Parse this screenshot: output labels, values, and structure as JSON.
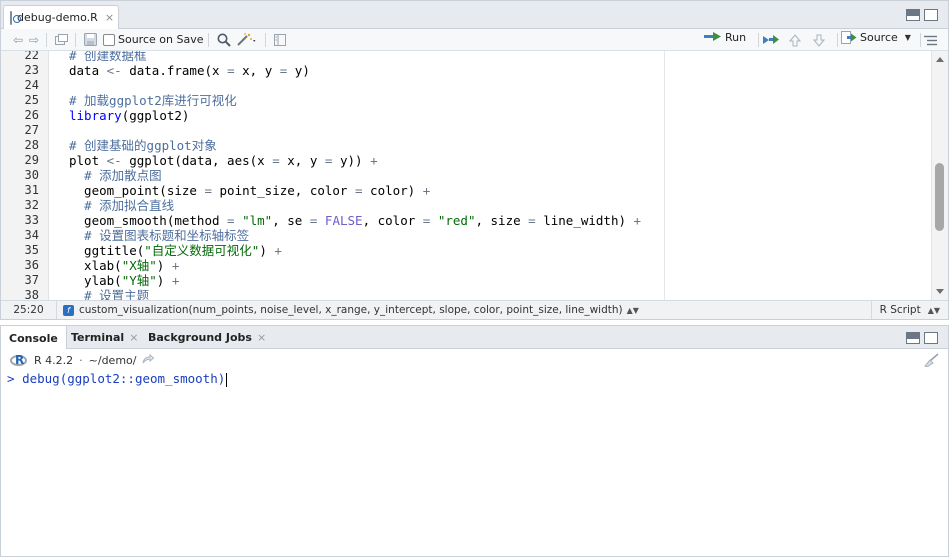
{
  "editor": {
    "tab": {
      "filename": "debug-demo.R",
      "close": "×"
    },
    "toolbar": {
      "source_on_save": "Source on Save",
      "run": "Run",
      "source": "Source"
    },
    "lines": [
      {
        "n": "22",
        "tokens": [
          [
            "cm",
            "# 创建数据框"
          ]
        ]
      },
      {
        "n": "23",
        "tokens": [
          [
            "fn",
            "data "
          ],
          [
            "op",
            "<-"
          ],
          [
            "fn",
            " data.frame(x "
          ],
          [
            "op",
            "="
          ],
          [
            "fn",
            " x, y "
          ],
          [
            "op",
            "="
          ],
          [
            "fn",
            " y)"
          ]
        ]
      },
      {
        "n": "24",
        "tokens": []
      },
      {
        "n": "25",
        "tokens": [
          [
            "cm",
            "# 加载ggplot2库进行可视化"
          ]
        ]
      },
      {
        "n": "26",
        "tokens": [
          [
            "kw",
            "library"
          ],
          [
            "fn",
            "(ggplot2)"
          ]
        ]
      },
      {
        "n": "27",
        "tokens": []
      },
      {
        "n": "28",
        "tokens": [
          [
            "cm",
            "# 创建基础的ggplot对象"
          ]
        ]
      },
      {
        "n": "29",
        "tokens": [
          [
            "fn",
            "plot "
          ],
          [
            "op",
            "<-"
          ],
          [
            "fn",
            " ggplot(data, aes(x "
          ],
          [
            "op",
            "="
          ],
          [
            "fn",
            " x, y "
          ],
          [
            "op",
            "="
          ],
          [
            "fn",
            " y)) "
          ],
          [
            "op",
            "+"
          ]
        ]
      },
      {
        "n": "30",
        "tokens": [
          [
            "fn",
            "  "
          ],
          [
            "cm",
            "# 添加散点图"
          ]
        ]
      },
      {
        "n": "31",
        "tokens": [
          [
            "fn",
            "  geom_point(size "
          ],
          [
            "op",
            "="
          ],
          [
            "fn",
            " point_size, color "
          ],
          [
            "op",
            "="
          ],
          [
            "fn",
            " color) "
          ],
          [
            "op",
            "+"
          ]
        ]
      },
      {
        "n": "32",
        "tokens": [
          [
            "fn",
            "  "
          ],
          [
            "cm",
            "# 添加拟合直线"
          ]
        ]
      },
      {
        "n": "33",
        "tokens": [
          [
            "fn",
            "  geom_smooth(method "
          ],
          [
            "op",
            "="
          ],
          [
            "fn",
            " "
          ],
          [
            "str",
            "\"lm\""
          ],
          [
            "fn",
            ", se "
          ],
          [
            "op",
            "="
          ],
          [
            "fn",
            " "
          ],
          [
            "bool",
            "FALSE"
          ],
          [
            "fn",
            ", color "
          ],
          [
            "op",
            "="
          ],
          [
            "fn",
            " "
          ],
          [
            "str",
            "\"red\""
          ],
          [
            "fn",
            ", size "
          ],
          [
            "op",
            "="
          ],
          [
            "fn",
            " line_width) "
          ],
          [
            "op",
            "+"
          ]
        ]
      },
      {
        "n": "34",
        "tokens": [
          [
            "fn",
            "  "
          ],
          [
            "cm",
            "# 设置图表标题和坐标轴标签"
          ]
        ]
      },
      {
        "n": "35",
        "tokens": [
          [
            "fn",
            "  ggtitle("
          ],
          [
            "str",
            "\"自定义数据可视化\""
          ],
          [
            "fn",
            ") "
          ],
          [
            "op",
            "+"
          ]
        ]
      },
      {
        "n": "36",
        "tokens": [
          [
            "fn",
            "  xlab("
          ],
          [
            "str",
            "\"X轴\""
          ],
          [
            "fn",
            ") "
          ],
          [
            "op",
            "+"
          ]
        ]
      },
      {
        "n": "37",
        "tokens": [
          [
            "fn",
            "  ylab("
          ],
          [
            "str",
            "\"Y轴\""
          ],
          [
            "fn",
            ") "
          ],
          [
            "op",
            "+"
          ]
        ]
      },
      {
        "n": "38",
        "tokens": [
          [
            "fn",
            "  "
          ],
          [
            "cm",
            "# 设置主题"
          ]
        ]
      }
    ],
    "status": {
      "cursor": "25:20",
      "function_badge": "f",
      "function_sig": "custom_visualization(num_points, noise_level, x_range, y_intercept, slope, color, point_size, line_width)",
      "file_type": "R Script"
    }
  },
  "console": {
    "tabs": [
      {
        "label": "Console"
      },
      {
        "label": "Terminal",
        "close": "×"
      },
      {
        "label": "Background Jobs",
        "close": "×"
      }
    ],
    "r_version": "R 4.2.2",
    "path": "~/demo/",
    "prompt": ">",
    "input": "debug(ggplot2::geom_smooth)"
  }
}
